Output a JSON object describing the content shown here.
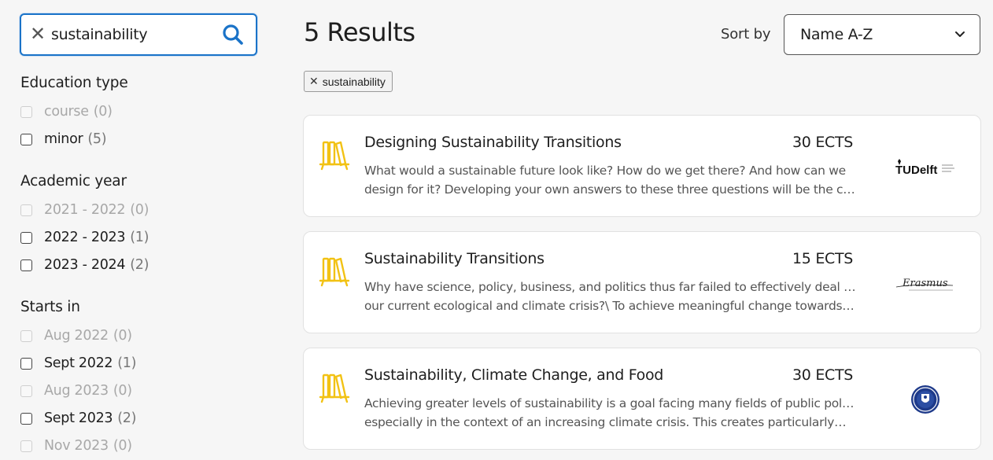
{
  "search": {
    "value": "sustainability",
    "clear_icon": "close-icon",
    "search_icon": "magnifier-icon"
  },
  "filters": {
    "education_type": {
      "title": "Education type",
      "options": [
        {
          "label": "course",
          "count": "(0)",
          "disabled": true
        },
        {
          "label": "minor",
          "count": "(5)",
          "disabled": false
        }
      ]
    },
    "academic_year": {
      "title": "Academic year",
      "options": [
        {
          "label": "2021 - 2022",
          "count": "(0)",
          "disabled": true
        },
        {
          "label": "2022 - 2023",
          "count": "(1)",
          "disabled": false
        },
        {
          "label": "2023 - 2024",
          "count": "(2)",
          "disabled": false
        }
      ]
    },
    "starts_in": {
      "title": "Starts in",
      "options": [
        {
          "label": "Aug 2022",
          "count": "(0)",
          "disabled": true
        },
        {
          "label": "Sept 2022",
          "count": "(1)",
          "disabled": false
        },
        {
          "label": "Aug 2023",
          "count": "(0)",
          "disabled": true
        },
        {
          "label": "Sept 2023",
          "count": "(2)",
          "disabled": false
        },
        {
          "label": "Nov 2023",
          "count": "(0)",
          "disabled": true
        }
      ]
    }
  },
  "header": {
    "results_title": "5 Results",
    "sort_label": "Sort by",
    "sort_value": "Name A-Z"
  },
  "active_chip": {
    "label": "sustainability"
  },
  "results": [
    {
      "title": "Designing Sustainability Transitions",
      "ects": "30 ECTS",
      "desc_line1": "What would a sustainable future look like? How do we get there? And how can we",
      "desc_line2": "design for it? Developing your own answers to these three questions will be the cor…",
      "logo_text": "TUDelft"
    },
    {
      "title": "Sustainability Transitions",
      "ects": "15 ECTS",
      "desc_line1": "Why have science, policy, business, and politics thus far failed to effectively deal with",
      "desc_line2": "our current ecological and climate crisis?\\ To achieve meaningful change towards…",
      "logo_text": "Erasmus"
    },
    {
      "title": "Sustainability, Climate Change, and Food",
      "ects": "30 ECTS",
      "desc_line1": "Achieving greater levels of sustainability is a goal facing many fields of public policy,",
      "desc_line2": "especially in the context of an increasing climate crisis. This creates particularly…",
      "logo_text": ""
    }
  ],
  "colors": {
    "accent": "#1a73c8",
    "book_icon": "#f2c214"
  }
}
